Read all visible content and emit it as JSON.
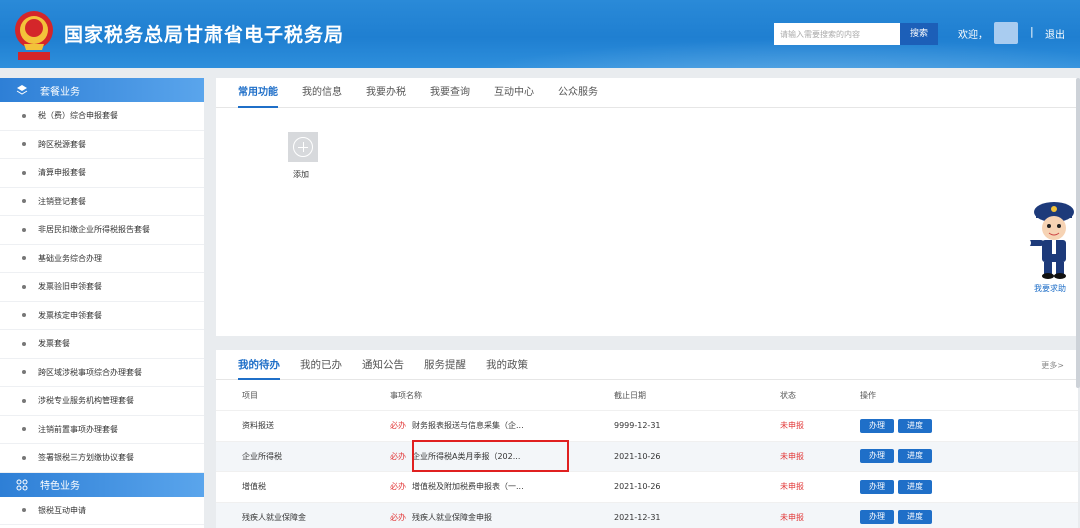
{
  "header": {
    "title": "国家税务总局甘肃省电子税务局",
    "search_placeholder": "请输入需要搜索的内容",
    "search_label": "搜索",
    "welcome": "欢迎，",
    "separator": "|",
    "logout": "退出"
  },
  "sidebar": {
    "section1": "套餐业务",
    "items": [
      "税（费）综合申报套餐",
      "跨区税源套餐",
      "清算申报套餐",
      "注销登记套餐",
      "非居民扣缴企业所得税报告套餐",
      "基础业务综合办理",
      "发票验旧申领套餐",
      "发票核定申领套餐",
      "发票套餐",
      "跨区域涉税事项综合办理套餐",
      "涉税专业服务机构管理套餐",
      "注销前置事项办理套餐",
      "签署银税三方划缴协议套餐"
    ],
    "section2": "特色业务",
    "items2": [
      "银税互动申请"
    ]
  },
  "top_tabs": [
    "常用功能",
    "我的信息",
    "我要办税",
    "我要查询",
    "互动中心",
    "公众服务"
  ],
  "add_label": "添加",
  "help_label": "我要求助",
  "bottom": {
    "tabs": [
      "我的待办",
      "我的已办",
      "通知公告",
      "服务提醒",
      "我的政策"
    ],
    "more": "更多>",
    "headers": [
      "项目",
      "事项名称",
      "截止日期",
      "状态",
      "操作"
    ],
    "must_label": "必办",
    "rows": [
      {
        "project": "资料报送",
        "name": "财务报表报送与信息采集（企...",
        "date": "9999-12-31",
        "status": "未申报"
      },
      {
        "project": "企业所得税",
        "name": "企业所得税A类月季报（202...",
        "date": "2021-10-26",
        "status": "未申报"
      },
      {
        "project": "增值税",
        "name": "增值税及附加税费申报表（一...",
        "date": "2021-10-26",
        "status": "未申报"
      },
      {
        "project": "残疾人就业保障金",
        "name": "残疾人就业保障金申报",
        "date": "2021-12-31",
        "status": "未申报"
      }
    ],
    "btn_handle": "办理",
    "btn_progress": "进度"
  },
  "colors": {
    "primary": "#1f6fc8",
    "header": "#2a8ad8",
    "alert": "#e23a3a"
  }
}
